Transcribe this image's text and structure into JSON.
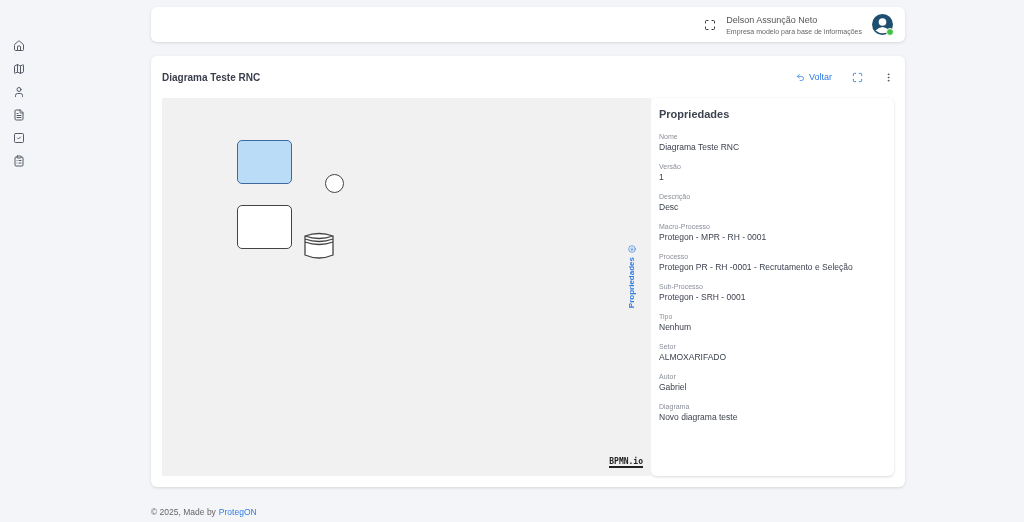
{
  "header": {
    "user_name": "Delson Assunção Neto",
    "company": "Empresa modelo para base de informações",
    "online": true
  },
  "card": {
    "title": "Diagrama Teste RNC",
    "back_label": "Voltar"
  },
  "canvas": {
    "elements": [
      {
        "kind": "task",
        "selected": true
      },
      {
        "kind": "event"
      },
      {
        "kind": "task",
        "selected": false
      },
      {
        "kind": "datastore"
      }
    ],
    "properties_tab": "Propriedades",
    "logo": "BPMN.io"
  },
  "properties": {
    "title": "Propriedades",
    "fields": [
      {
        "label": "Nome",
        "value": "Diagrama Teste RNC"
      },
      {
        "label": "Versão",
        "value": "1"
      },
      {
        "label": "Descrição",
        "value": "Desc"
      },
      {
        "label": "Macro-Processo",
        "value": "Protegon - MPR - RH - 0001"
      },
      {
        "label": "Processo",
        "value": "Protegon PR - RH -0001 - Recrutamento e Seleção"
      },
      {
        "label": "Sub-Processo",
        "value": "Protegon - SRH - 0001"
      },
      {
        "label": "Tipo",
        "value": "Nenhum"
      },
      {
        "label": "Setor",
        "value": "ALMOXARIFADO"
      },
      {
        "label": "Autor",
        "value": "Gabriel"
      },
      {
        "label": "Diagrama",
        "value": "Novo diagrama teste"
      }
    ]
  },
  "footer": {
    "text": "© 2025, Made by",
    "link": "ProtegON"
  }
}
